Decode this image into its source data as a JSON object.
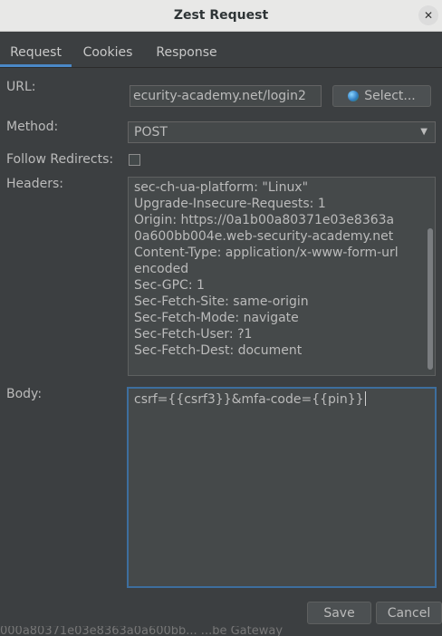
{
  "dialog": {
    "title": "Zest Request",
    "close_icon": "close-icon"
  },
  "tabs": [
    {
      "label": "Request",
      "active": true
    },
    {
      "label": "Cookies",
      "active": false
    },
    {
      "label": "Response",
      "active": false
    }
  ],
  "url": {
    "label": "URL:",
    "value": "ecurity-academy.net/login2",
    "select_label": "Select..."
  },
  "method": {
    "label": "Method:",
    "value": "POST"
  },
  "follow_redirects": {
    "label": "Follow Redirects:",
    "checked": false
  },
  "headers": {
    "label": "Headers:",
    "lines": [
      "sec-ch-ua-platform: \"Linux\"",
      "Upgrade-Insecure-Requests: 1",
      "Origin: https://0a1b00a80371e03e8363a",
      "0a600bb004e.web-security-academy.net",
      "Content-Type: application/x-www-form-url",
      "encoded",
      "Sec-GPC: 1",
      "Sec-Fetch-Site: same-origin",
      "Sec-Fetch-Mode: navigate",
      "Sec-Fetch-User: ?1",
      "Sec-Fetch-Dest: document"
    ]
  },
  "body": {
    "label": "Body:",
    "value": "csrf={{csrf3}}&mfa-code={{pin}}"
  },
  "buttons": {
    "save": "Save",
    "cancel": "Cancel"
  },
  "background_text": "000a80371e03e8363a0a600bb... ...be Gateway"
}
